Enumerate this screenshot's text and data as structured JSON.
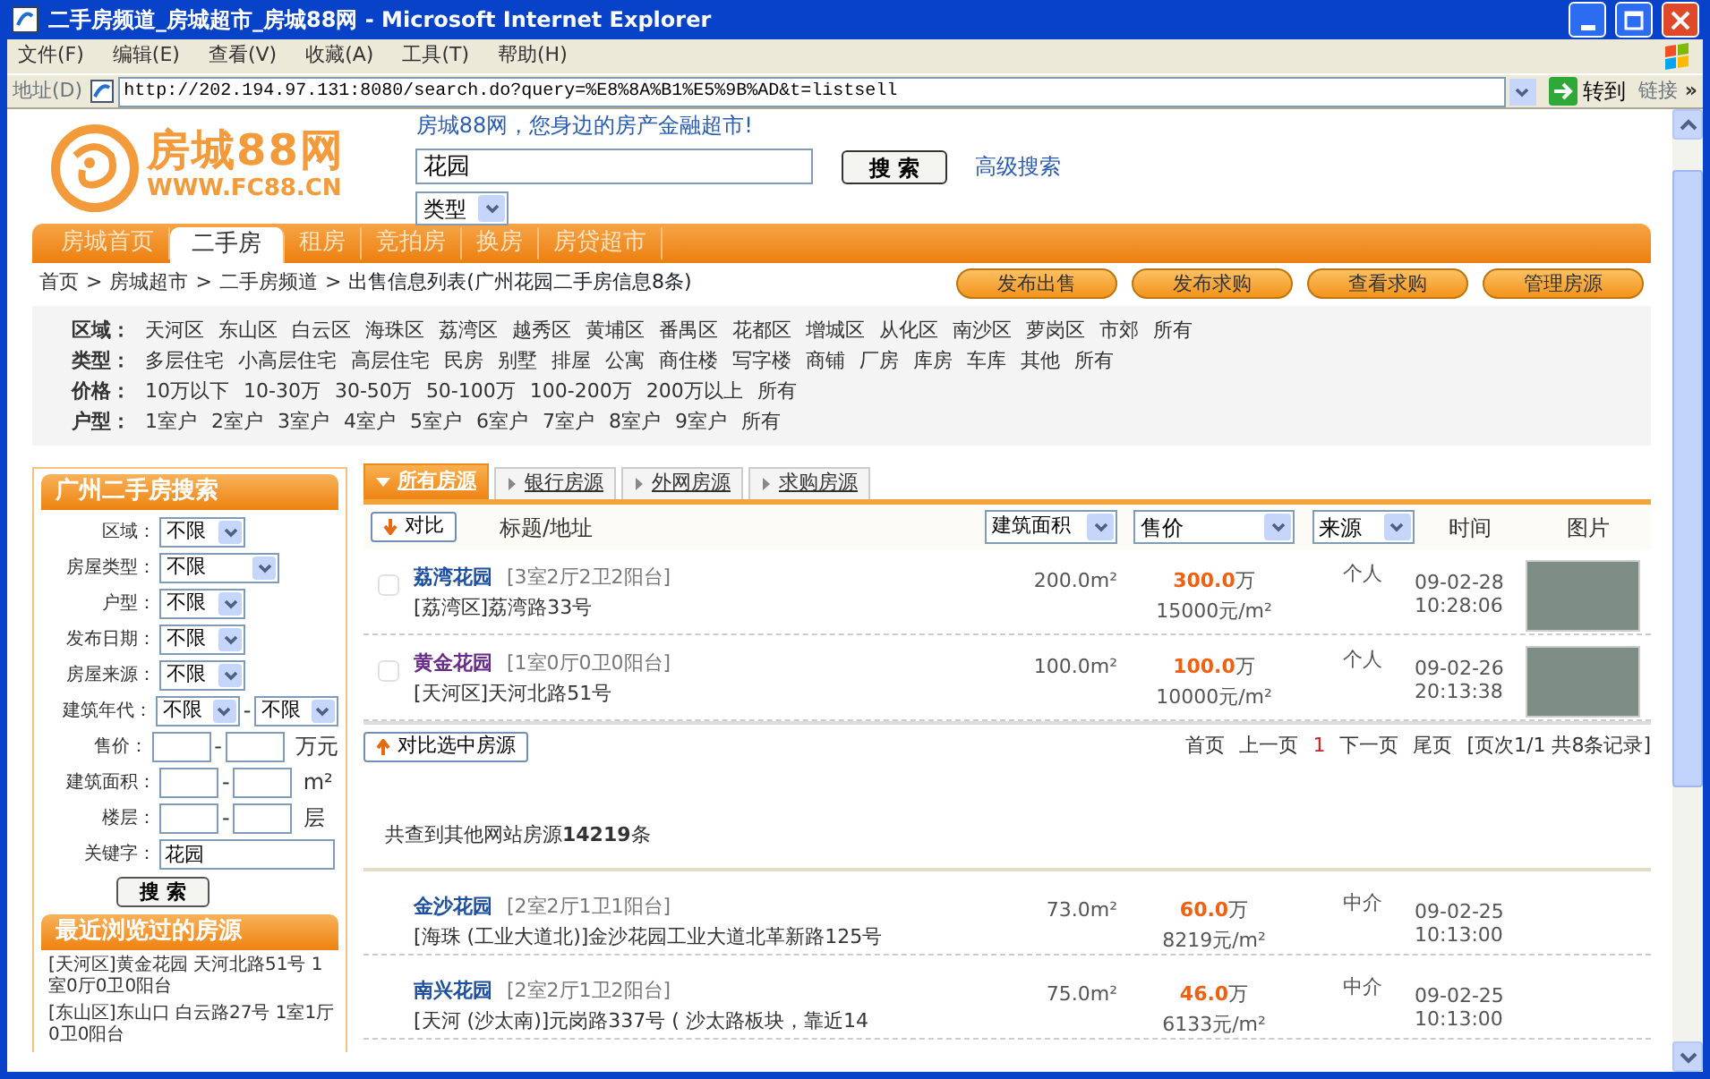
{
  "window": {
    "title": "二手房频道_房城超市_房城88网 - Microsoft Internet Explorer",
    "menu": [
      "文件(F)",
      "编辑(E)",
      "查看(V)",
      "收藏(A)",
      "工具(T)",
      "帮助(H)"
    ],
    "address_label": "地址(D)",
    "url": "http://202.194.97.131:8080/search.do?query=%E8%8A%B1%E5%9B%AD&t=listsell",
    "go_button": "转到",
    "links_label": "链接",
    "more": "»"
  },
  "header": {
    "logo_name": "房城88网",
    "logo_url": "WWW.FC88.CN",
    "slogan": "房城88网，您身边的房产金融超市!",
    "search_value": "花园",
    "search_button": "搜 索",
    "type_select": "类型",
    "advanced_link": "高级搜索"
  },
  "nav_tabs": [
    {
      "label": "房城首页",
      "selected": false
    },
    {
      "label": "二手房",
      "selected": true
    },
    {
      "label": "租房",
      "selected": false
    },
    {
      "label": "竞拍房",
      "selected": false
    },
    {
      "label": "换房",
      "selected": false
    },
    {
      "label": "房贷超市",
      "selected": false
    }
  ],
  "breadcrumb": [
    {
      "kind": "link",
      "label": "首页"
    },
    {
      "kind": "separator",
      "label": ">"
    },
    {
      "kind": "link",
      "label": "房城超市"
    },
    {
      "kind": "separator",
      "label": ">"
    },
    {
      "kind": "link",
      "label": "二手房频道"
    },
    {
      "kind": "separator",
      "label": ">"
    },
    {
      "kind": "current",
      "label": "出售信息列表(广州花园二手房信息8条)"
    }
  ],
  "action_buttons": [
    "发布出售",
    "发布求购",
    "查看求购",
    "管理房源"
  ],
  "filters": [
    {
      "label": "区域：",
      "options": [
        "天河区",
        "东山区",
        "白云区",
        "海珠区",
        "荔湾区",
        "越秀区",
        "黄埔区",
        "番禺区",
        "花都区",
        "增城区",
        "从化区",
        "南沙区",
        "萝岗区",
        "市郊",
        "所有"
      ]
    },
    {
      "label": "类型：",
      "options": [
        "多层住宅",
        "小高层住宅",
        "高层住宅",
        "民房",
        "别墅",
        "排屋",
        "公寓",
        "商住楼",
        "写字楼",
        "商铺",
        "厂房",
        "库房",
        "车库",
        "其他",
        "所有"
      ]
    },
    {
      "label": "价格：",
      "options": [
        "10万以下",
        "10-30万",
        "30-50万",
        "50-100万",
        "100-200万",
        "200万以上",
        "所有"
      ]
    },
    {
      "label": "户型：",
      "options": [
        "1室户",
        "2室户",
        "3室户",
        "4室户",
        "5室户",
        "6室户",
        "7室户",
        "8室户",
        "9室户",
        "所有"
      ]
    }
  ],
  "sidebar": {
    "title": "广州二手房搜索",
    "fields": [
      {
        "label": "区域：",
        "kind": "select",
        "value": "不限"
      },
      {
        "label": "房屋类型：",
        "kind": "wide_select",
        "value": "不限"
      },
      {
        "label": "户型：",
        "kind": "select",
        "value": "不限"
      },
      {
        "label": "发布日期：",
        "kind": "select",
        "value": "不限"
      },
      {
        "label": "房屋来源：",
        "kind": "select",
        "value": "不限"
      },
      {
        "label": "建筑年代：",
        "kind": "select_pair",
        "values": [
          "不限",
          "不限"
        ],
        "joiner": "-"
      },
      {
        "label": "售价：",
        "kind": "range",
        "joiner": "-",
        "unit": "万元"
      },
      {
        "label": "建筑面积：",
        "kind": "range",
        "joiner": "-",
        "unit": "m²"
      },
      {
        "label": "楼层：",
        "kind": "range",
        "joiner": "-",
        "unit": "层"
      },
      {
        "label": "关键字：",
        "kind": "text",
        "value": "花园"
      }
    ],
    "search_button": "搜 索",
    "recent_title": "最近浏览过的房源",
    "recent_items": [
      "[天河区]黄金花园 天河北路51号 1室0厅0卫0阳台",
      "[东山区]东山口 白云路27号 1室1厅0卫0阳台"
    ]
  },
  "main": {
    "tabs": [
      {
        "label": "所有房源",
        "selected": true
      },
      {
        "label": "银行房源",
        "selected": false
      },
      {
        "label": "外网房源",
        "selected": false
      },
      {
        "label": "求购房源",
        "selected": false
      }
    ],
    "compare_button": "对比",
    "title_column": "标题/地址",
    "sort_selects": [
      "建筑面积",
      "售价",
      "来源"
    ],
    "time_column": "时间",
    "photo_column": "图片",
    "listings": [
      {
        "checked": false,
        "title": "荔湾花园",
        "visited": false,
        "layout": "[3室2厅2卫2阳台]",
        "address": "[荔湾区]荔湾路33号",
        "area": "200.0m²",
        "price": "300.0",
        "price_unit": "万",
        "unit_price": "15000元/m²",
        "source": "个人",
        "date": "09-02-28",
        "time": "10:28:06",
        "photo": true
      },
      {
        "checked": false,
        "title": "黄金花园",
        "visited": true,
        "layout": "[1室0厅0卫0阳台]",
        "address": "[天河区]天河北路51号",
        "area": "100.0m²",
        "price": "100.0",
        "price_unit": "万",
        "unit_price": "10000元/m²",
        "source": "个人",
        "date": "09-02-26",
        "time": "20:13:38",
        "photo": true
      }
    ],
    "compare_selected_button": "对比选中房源",
    "pagination": [
      {
        "label": "首页",
        "selected": false
      },
      {
        "label": "上一页",
        "selected": false
      },
      {
        "label": "1",
        "selected": true
      },
      {
        "label": "下一页",
        "selected": false
      },
      {
        "label": "尾页",
        "selected": false
      }
    ],
    "page_summary": "[页次1/1 共8条记录]",
    "external_summary": {
      "prefix": "共查到",
      "link": "其他网站房源",
      "rest": "**14219**条"
    },
    "external_listings": [
      {
        "title": "金沙花园",
        "layout": "[2室2厅1卫1阳台]",
        "address": "[海珠 (工业大道北)]金沙花园工业大道北革新路125号",
        "area": "73.0m²",
        "price": "60.0",
        "price_unit": "万",
        "unit_price": "8219元/m²",
        "source": "中介",
        "date": "09-02-25",
        "time": "10:13:00"
      },
      {
        "title": "南兴花园",
        "layout": "[2室2厅1卫2阳台]",
        "address": "[天河 (沙太南)]元岗路337号 ( 沙太路板块，靠近14",
        "area": "75.0m²",
        "price": "46.0",
        "price_unit": "万",
        "unit_price": "6133元/m²",
        "source": "中介",
        "date": "09-02-25",
        "time": "10:13:00"
      }
    ]
  }
}
